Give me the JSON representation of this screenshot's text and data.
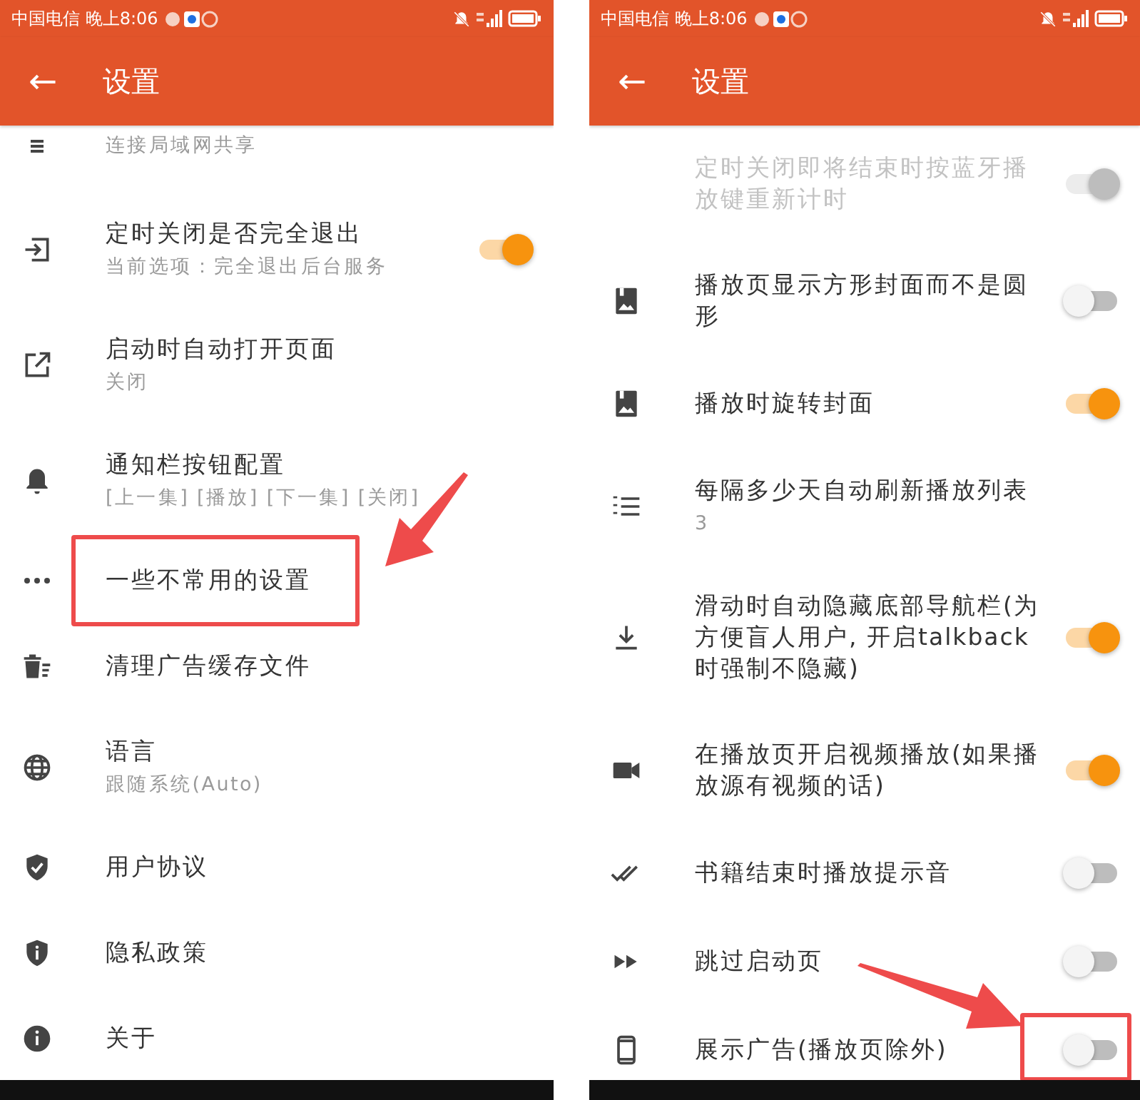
{
  "panels": [
    {
      "status_bar": {
        "carrier_time": "中国电信 晚上8:06"
      },
      "app_bar": {
        "back": "←",
        "title": "设置"
      },
      "items": [
        {
          "kind": "nav",
          "subtitle": "连接局域网共享",
          "partial": true
        },
        {
          "kind": "switch",
          "title": "定时关闭是否完全退出",
          "subtitle": "当前选项：完全退出后台服务",
          "on": true,
          "disabled": false
        },
        {
          "kind": "nav",
          "title": "启动时自动打开页面",
          "subtitle": "关闭"
        },
        {
          "kind": "nav",
          "title": "通知栏按钮配置",
          "subtitle": "[上一集] [播放] [下一集] [关闭]"
        },
        {
          "kind": "nav",
          "title": "一些不常用的设置",
          "highlighted": true
        },
        {
          "kind": "nav",
          "title": "清理广告缓存文件"
        },
        {
          "kind": "nav",
          "title": "语言",
          "subtitle": "跟随系统(Auto)"
        },
        {
          "kind": "nav",
          "title": "用户协议"
        },
        {
          "kind": "nav",
          "title": "隐私政策"
        },
        {
          "kind": "nav",
          "title": "关于"
        }
      ]
    },
    {
      "status_bar": {
        "carrier_time": "中国电信 晚上8:06"
      },
      "app_bar": {
        "back": "←",
        "title": "设置"
      },
      "items": [
        {
          "kind": "switch",
          "title": "定时关闭即将结束时按蓝牙播放键重新计时",
          "on": true,
          "disabled": true
        },
        {
          "kind": "switch",
          "title": "播放页显示方形封面而不是圆形",
          "on": false,
          "disabled": false
        },
        {
          "kind": "switch",
          "title": "播放时旋转封面",
          "on": true,
          "disabled": false
        },
        {
          "kind": "nav",
          "title": "每隔多少天自动刷新播放列表",
          "subtitle": "3"
        },
        {
          "kind": "switch",
          "title": "滑动时自动隐藏底部导航栏(为方便盲人用户, 开启talkback 时强制不隐藏)",
          "on": true,
          "disabled": false
        },
        {
          "kind": "switch",
          "title": "在播放页开启视频播放(如果播放源有视频的话)",
          "on": true,
          "disabled": false
        },
        {
          "kind": "switch",
          "title": "书籍结束时播放提示音",
          "on": false,
          "disabled": false
        },
        {
          "kind": "switch",
          "title": "跳过启动页",
          "on": false,
          "disabled": false
        },
        {
          "kind": "switch",
          "title": "展示广告(播放页除外)",
          "on": false,
          "disabled": false,
          "highlighted": true
        }
      ]
    }
  ]
}
